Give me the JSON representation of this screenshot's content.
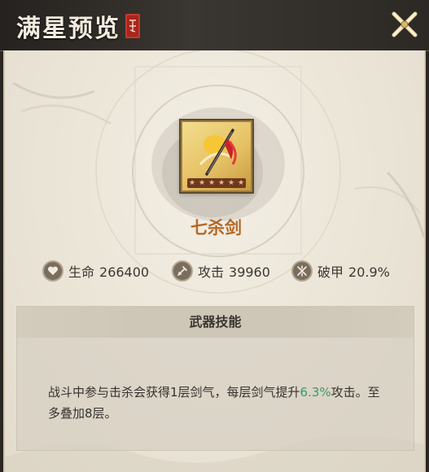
{
  "window": {
    "title": "满星预览",
    "close_icon": "close-x-icon"
  },
  "item": {
    "name": "七杀剑",
    "star_count": 6,
    "frame_color": "#e6c266"
  },
  "stats": [
    {
      "icon": "heart-icon",
      "label": "生命",
      "value": "266400"
    },
    {
      "icon": "sword-icon",
      "label": "攻击",
      "value": "39960"
    },
    {
      "icon": "armor-break-icon",
      "label": "破甲",
      "value": "20.9%"
    }
  ],
  "skill": {
    "header": "武器技能",
    "desc_before": "战斗中参与击杀会获得1层剑气，每层剑气提升",
    "highlight": "6.3%",
    "desc_after": "攻击。至多叠加8层。",
    "highlight_color": "#3a9a63"
  }
}
